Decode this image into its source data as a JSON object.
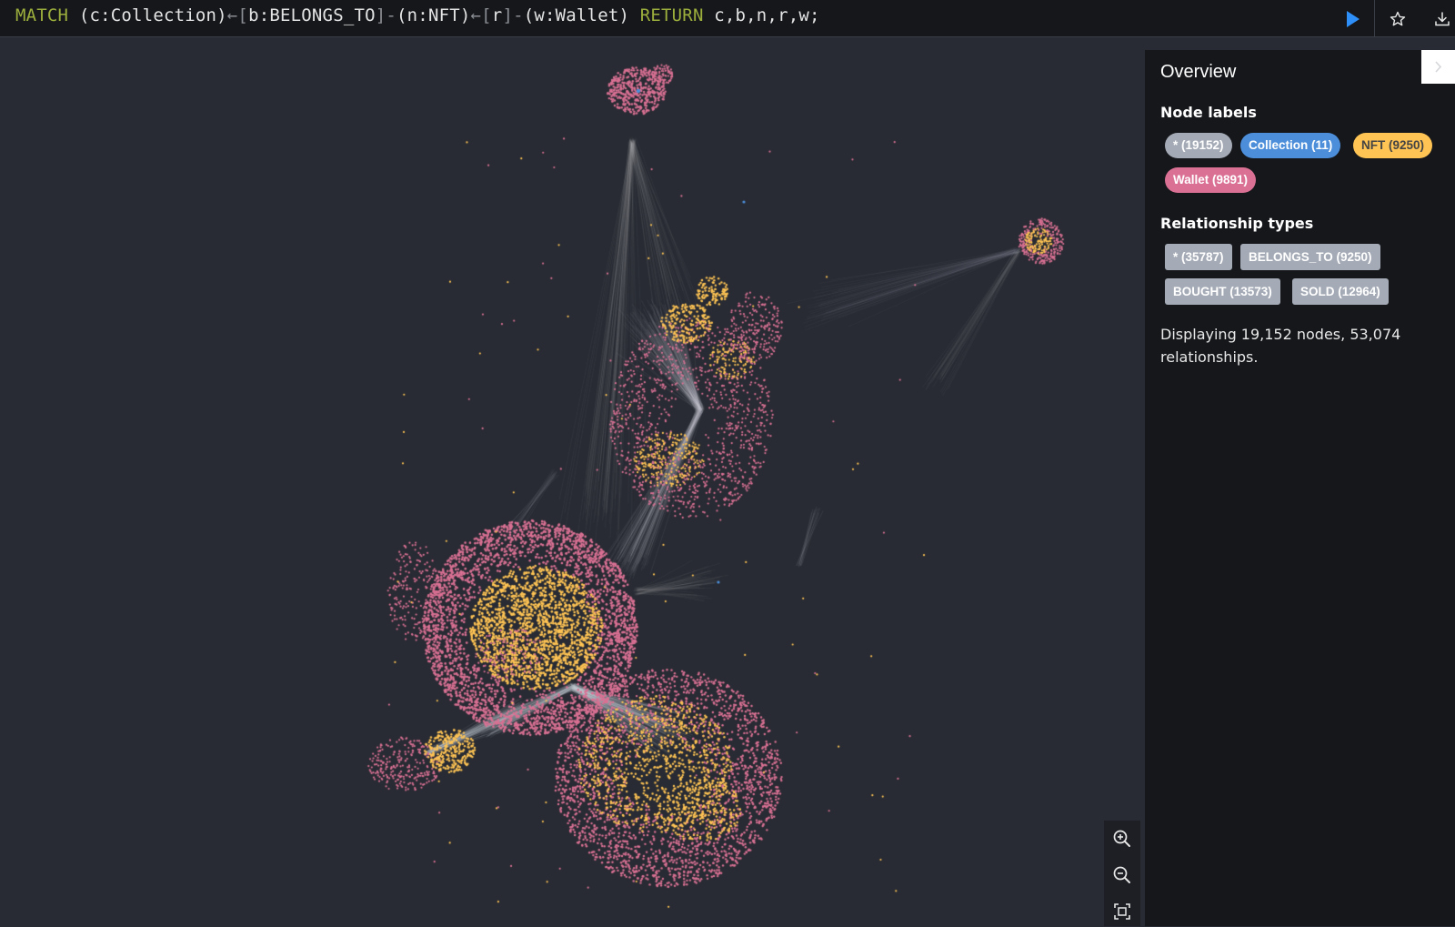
{
  "query": {
    "kw_match": "MATCH",
    "part1": "(c:Collection)",
    "arrow1": "←[",
    "part2": "b:BELONGS_TO",
    "arrow2": "]-",
    "part3": "(n:NFT)",
    "arrow3": "←[",
    "part4": "r",
    "arrow4": "]-",
    "part5": "(w:Wallet)",
    "kw_return": "RETURN",
    "returns": "c,b,n,r,w;"
  },
  "toolbar": {
    "run_icon": "play-icon",
    "favorite_icon": "star-icon",
    "download_icon": "download-icon"
  },
  "overview": {
    "title": "Overview",
    "node_labels_title": "Node labels",
    "node_labels": [
      {
        "label": "* (19152)",
        "color": "#a5abb6",
        "text_color": "#ffffff"
      },
      {
        "label": "Collection (11)",
        "color": "#4c8eda",
        "text_color": "#ffffff"
      },
      {
        "label": "NFT (9250)",
        "color": "#ffc454",
        "text_color": "#444444"
      },
      {
        "label": "Wallet (9891)",
        "color": "#da7194",
        "text_color": "#ffffff"
      }
    ],
    "relationship_types_title": "Relationship types",
    "relationship_types": [
      {
        "label": "* (35787)"
      },
      {
        "label": "BELONGS_TO (9250)"
      },
      {
        "label": "BOUGHT (13573)"
      },
      {
        "label": "SOLD (12964)"
      }
    ],
    "display_text": "Displaying 19,152 nodes, 53,074 relationships."
  },
  "graph": {
    "node_colors": {
      "collection": "#4c8eda",
      "nft": "#ffc454",
      "wallet": "#da7194",
      "edge": "#c8ccd4"
    },
    "zoom_controls": {
      "zoom_in_icon": "zoom-in-icon",
      "zoom_out_icon": "zoom-out-icon",
      "fit_icon": "fit-to-screen-icon"
    }
  }
}
